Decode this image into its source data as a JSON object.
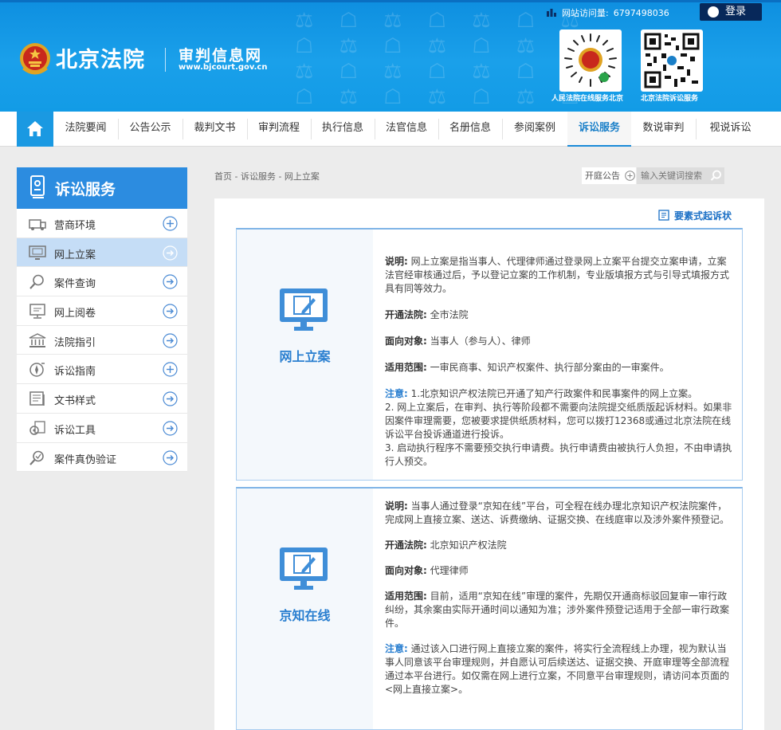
{
  "header": {
    "court_name": "北京法院",
    "site_name": "审判信息网",
    "site_url": "www.bjcourt.gov.cn",
    "visit_label": "网站访问量:",
    "visit_count": "6797498036",
    "login_label": "登录",
    "qr_codes": [
      {
        "label": "人民法院在线服务北京"
      },
      {
        "label": "北京法院诉讼服务"
      }
    ]
  },
  "nav": {
    "home_icon": "home-icon",
    "items": [
      {
        "label": "法院要闻"
      },
      {
        "label": "公告公示"
      },
      {
        "label": "裁判文书"
      },
      {
        "label": "审判流程"
      },
      {
        "label": "执行信息"
      },
      {
        "label": "法官信息"
      },
      {
        "label": "名册信息"
      },
      {
        "label": "参阅案例"
      },
      {
        "label": "诉讼服务"
      },
      {
        "label": "数说审判"
      },
      {
        "label": "视说诉讼"
      }
    ],
    "active": "诉讼服务"
  },
  "sidebar": {
    "title": "诉讼服务",
    "items": [
      {
        "label": "营商环境",
        "icon": "business-env-icon",
        "arrow": "plus-circle-icon"
      },
      {
        "label": "网上立案",
        "icon": "computer-icon",
        "arrow": "arrow-circle-icon"
      },
      {
        "label": "案件查询",
        "icon": "magnifier-icon",
        "arrow": "arrow-circle-icon"
      },
      {
        "label": "网上阅卷",
        "icon": "monitor-icon",
        "arrow": "arrow-circle-icon"
      },
      {
        "label": "法院指引",
        "icon": "courthouse-icon",
        "arrow": "arrow-circle-icon"
      },
      {
        "label": "诉讼指南",
        "icon": "compass-icon",
        "arrow": "plus-circle-icon"
      },
      {
        "label": "文书样式",
        "icon": "book-icon",
        "arrow": "arrow-circle-icon"
      },
      {
        "label": "诉讼工具",
        "icon": "tools-icon",
        "arrow": "arrow-circle-icon"
      },
      {
        "label": "案件真伪验证",
        "icon": "verify-icon",
        "arrow": "arrow-circle-icon"
      }
    ],
    "active": "网上立案"
  },
  "breadcrumb": "首页 - 诉讼服务 - 网上立案",
  "notice_label": "开庭公告",
  "search_placeholder": "输入关键词搜索",
  "form_link": "要素式起诉状",
  "cards": [
    {
      "name": "网上立案",
      "desc_label": "说明:",
      "desc": "网上立案是指当事人、代理律师通过登录网上立案平台提交立案申请，立案法官经审核通过后，予以登记立案的工作机制，专业版填报方式与引导式填报方式具有同等效力。",
      "court_label": "开通法院:",
      "court": "全市法院",
      "target_label": "面向对象:",
      "target": "当事人（参与人）、律师",
      "scope_label": "适用范围:",
      "scope": "一审民商事、知识产权案件、执行部分案由的一审案件。",
      "note_label": "注意:",
      "note_lines": [
        "1.北京知识产权法院已开通了知产行政案件和民事案件的网上立案。",
        "2. 网上立案后，在审判、执行等阶段都不需要向法院提交纸质版起诉材料。如果非因案件审理需要，您被要求提供纸质材料，您可以拨打12368或通过北京法院在线诉讼平台投诉通道进行投诉。",
        "3. 启动执行程序不需要预交执行申请费。执行申请费由被执行人负担，不由申请执行人预交。"
      ]
    },
    {
      "name": "京知在线",
      "desc_label": "说明:",
      "desc": "当事人通过登录“京知在线”平台，可全程在线办理北京知识产权法院案件，完成网上直接立案、送达、诉费缴纳、证据交换、在线庭审以及涉外案件预登记。",
      "court_label": "开通法院:",
      "court": "北京知识产权法院",
      "target_label": "面向对象:",
      "target": "代理律师",
      "scope_label": "适用范围:",
      "scope": "目前，适用“京知在线”审理的案件，先期仅开通商标驳回复审一审行政纠纷，其余案由实际开通时间以通知为准；涉外案件预登记适用于全部一审行政案件。",
      "note_label": "注意:",
      "note_lines": [
        "通过该入口进行网上直接立案的案件，将实行全流程线上办理，视为默认当事人同意该平台审理规则，并自愿认可后续送达、证据交换、开庭审理等全部流程通过本平台进行。如仅需在网上进行立案，不同意平台审理规则，请访问本页面的<网上直接立案>。"
      ]
    }
  ],
  "colors": {
    "header_blue": "#1aa0ea",
    "nav_active": "#1a7fc8",
    "sidebar_head": "#2c8ce0",
    "sidebar_active": "#c5ddf6"
  }
}
